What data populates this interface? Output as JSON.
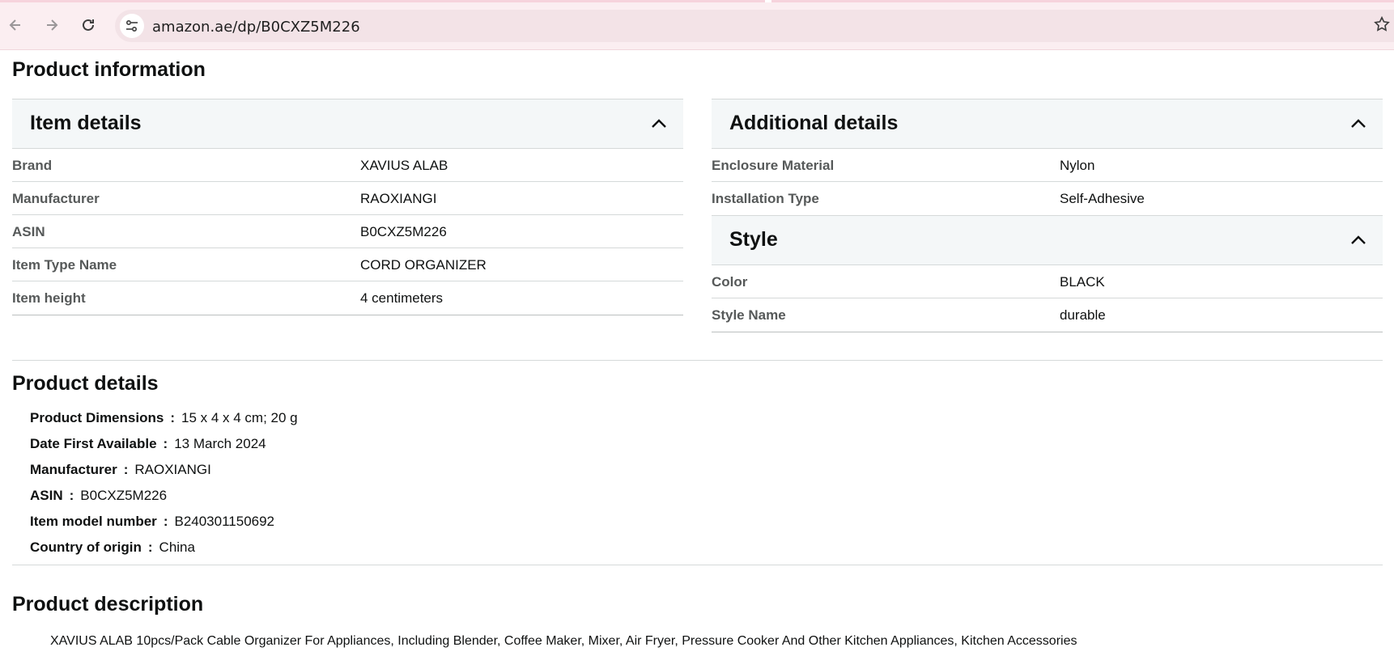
{
  "browser": {
    "url": "amazon.ae/dp/B0CXZ5M226",
    "icons": {
      "back": "back-arrow-icon",
      "forward": "forward-arrow-icon",
      "reload": "reload-icon",
      "site_info": "site-info-icon",
      "bookmark": "star-icon"
    }
  },
  "product_information": {
    "title": "Product information",
    "item_details": {
      "title": "Item details",
      "rows": [
        {
          "key": "Brand",
          "value": "XAVIUS ALAB"
        },
        {
          "key": "Manufacturer",
          "value": "RAOXIANGI"
        },
        {
          "key": "ASIN",
          "value": "B0CXZ5M226"
        },
        {
          "key": "Item Type Name",
          "value": "CORD ORGANIZER"
        },
        {
          "key": "Item height",
          "value": "4 centimeters"
        }
      ]
    },
    "additional_details": {
      "title": "Additional details",
      "rows": [
        {
          "key": "Enclosure Material",
          "value": "Nylon"
        },
        {
          "key": "Installation Type",
          "value": "Self-Adhesive"
        }
      ]
    },
    "style": {
      "title": "Style",
      "rows": [
        {
          "key": "Color",
          "value": "BLACK"
        },
        {
          "key": "Style Name",
          "value": "durable"
        }
      ]
    }
  },
  "product_details": {
    "title": "Product details",
    "separator": ":",
    "items": [
      {
        "key": "Product Dimensions",
        "value": "15 x 4 x 4 cm; 20 g"
      },
      {
        "key": "Date First Available",
        "value": "13 March 2024"
      },
      {
        "key": "Manufacturer",
        "value": "RAOXIANGI"
      },
      {
        "key": "ASIN",
        "value": "B0CXZ5M226"
      },
      {
        "key": "Item model number",
        "value": "B240301150692"
      },
      {
        "key": "Country of origin",
        "value": "China"
      }
    ]
  },
  "product_description": {
    "title": "Product description",
    "text": "XAVIUS ALAB 10pcs/Pack Cable Organizer For Appliances, Including Blender, Coffee Maker, Mixer, Air Fryer, Pressure Cooker And Other Kitchen Appliances, Kitchen Accessories"
  }
}
